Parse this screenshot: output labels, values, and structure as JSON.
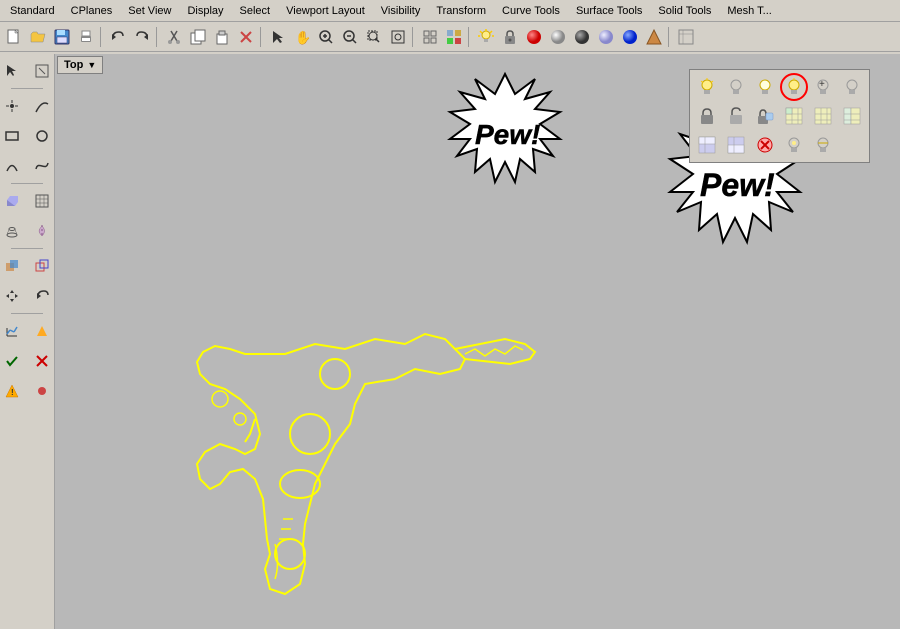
{
  "menubar": {
    "items": [
      "Standard",
      "CPlanes",
      "Set View",
      "Display",
      "Select",
      "Viewport Layout",
      "Visibility",
      "Transform",
      "Curve Tools",
      "Surface Tools",
      "Solid Tools",
      "Mesh T..."
    ]
  },
  "toolbar": {
    "buttons": [
      {
        "icon": "📄",
        "name": "new"
      },
      {
        "icon": "📂",
        "name": "open"
      },
      {
        "icon": "💾",
        "name": "save"
      },
      {
        "icon": "🖨",
        "name": "print"
      },
      {
        "icon": "↩",
        "name": "undo"
      },
      {
        "icon": "↪",
        "name": "redo"
      },
      {
        "icon": "✂",
        "name": "cut"
      },
      {
        "icon": "📋",
        "name": "copy"
      },
      {
        "icon": "📌",
        "name": "paste"
      },
      {
        "icon": "🗑",
        "name": "delete"
      },
      {
        "icon": "↖",
        "name": "select"
      },
      {
        "icon": "✋",
        "name": "pan"
      },
      {
        "icon": "🔍",
        "name": "zoom"
      },
      {
        "icon": "⬜",
        "name": "box"
      },
      {
        "icon": "⭕",
        "name": "circle"
      },
      {
        "icon": "🔁",
        "name": "rotate"
      },
      {
        "icon": "💡",
        "name": "light"
      },
      {
        "icon": "🔒",
        "name": "lock"
      },
      {
        "icon": "🎨",
        "name": "color"
      },
      {
        "icon": "⚙",
        "name": "settings"
      }
    ]
  },
  "sidebar": {
    "buttons": [
      {
        "icon": "⊕",
        "name": "point"
      },
      {
        "icon": "⌒",
        "name": "arc"
      },
      {
        "icon": "⬜",
        "name": "rectangle"
      },
      {
        "icon": "⭕",
        "name": "circle2"
      },
      {
        "icon": "〰",
        "name": "curve"
      },
      {
        "icon": "◈",
        "name": "surface"
      },
      {
        "icon": "▣",
        "name": "grid"
      },
      {
        "icon": "↕",
        "name": "move"
      },
      {
        "icon": "⬡",
        "name": "solid"
      },
      {
        "icon": "🔆",
        "name": "light2"
      },
      {
        "icon": "◧",
        "name": "split"
      },
      {
        "icon": "⊞",
        "name": "boolean"
      },
      {
        "icon": "✓",
        "name": "confirm"
      },
      {
        "icon": "✗",
        "name": "cancel"
      },
      {
        "icon": "⚠",
        "name": "warning"
      }
    ]
  },
  "viewport": {
    "label": "Top",
    "arrow": "▼"
  },
  "floating_toolbar": {
    "rows": [
      [
        {
          "icon": "💡",
          "name": "light-on",
          "active": false
        },
        {
          "icon": "💡",
          "name": "light-off",
          "active": false
        },
        {
          "icon": "💡",
          "name": "light-dim",
          "active": false
        },
        {
          "icon": "💡",
          "name": "light-selected",
          "active": true
        },
        {
          "icon": "💡",
          "name": "light-add",
          "active": false
        },
        {
          "icon": "💡",
          "name": "light-remove",
          "active": false
        }
      ],
      [
        {
          "icon": "🔒",
          "name": "lock1",
          "active": false
        },
        {
          "icon": "🔓",
          "name": "unlock1",
          "active": false
        },
        {
          "icon": "🔒",
          "name": "lock2",
          "active": false
        },
        {
          "icon": "▣",
          "name": "grid1",
          "active": false
        },
        {
          "icon": "▣",
          "name": "grid2",
          "active": false
        },
        {
          "icon": "▣",
          "name": "grid3",
          "active": false
        }
      ],
      [
        {
          "icon": "◫",
          "name": "panel1",
          "active": false
        },
        {
          "icon": "◪",
          "name": "panel2",
          "active": false
        },
        {
          "icon": "❌",
          "name": "remove",
          "active": false
        },
        {
          "icon": "💡",
          "name": "light3",
          "active": false
        },
        {
          "icon": "💡",
          "name": "light4",
          "active": false
        },
        {
          "icon": "",
          "name": "empty",
          "active": false
        }
      ]
    ]
  }
}
